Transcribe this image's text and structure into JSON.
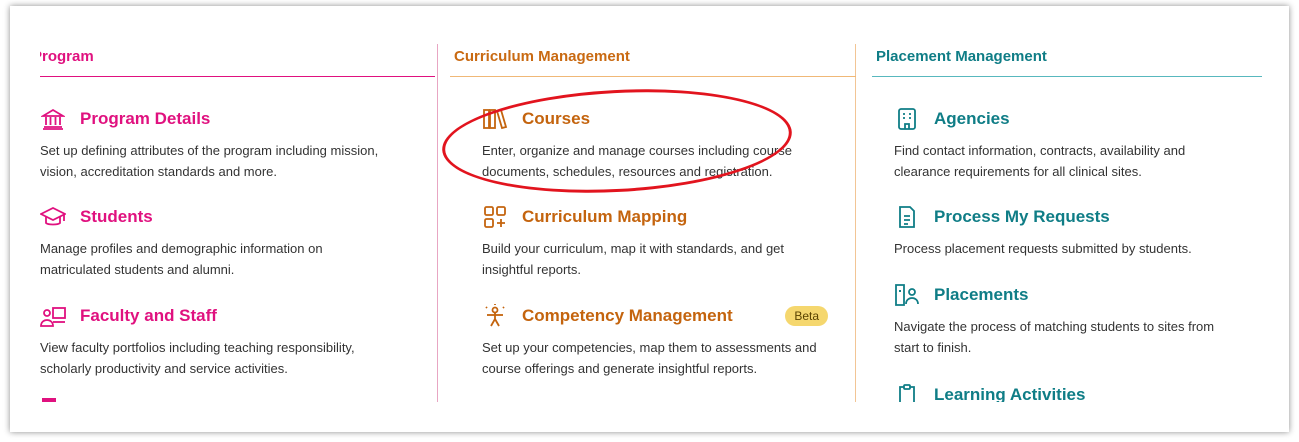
{
  "columns": {
    "program": {
      "header": "Program",
      "items": [
        {
          "title": "Program Details",
          "icon": "institution-icon",
          "desc": "Set up defining attributes of the program including mission, vision, accreditation standards and more."
        },
        {
          "title": "Students",
          "icon": "graduation-cap-icon",
          "desc": "Manage profiles and demographic information on matriculated students and alumni."
        },
        {
          "title": "Faculty and Staff",
          "icon": "presenter-icon",
          "desc": "View faculty portfolios including teaching responsibility, scholarly productivity and service activities."
        }
      ]
    },
    "curriculum": {
      "header": "Curriculum Management",
      "items": [
        {
          "title": "Courses",
          "icon": "books-icon",
          "desc": "Enter, organize and manage courses including course documents, schedules, resources and registration."
        },
        {
          "title": "Curriculum Mapping",
          "icon": "grid-plus-icon",
          "desc": "Build your curriculum, map it with standards, and get insightful reports."
        },
        {
          "title": "Competency Management",
          "icon": "competency-icon",
          "badge": "Beta",
          "desc": "Set up your competencies, map them to assessments and course offerings and generate insightful reports."
        }
      ]
    },
    "placement": {
      "header": "Placement Management",
      "items": [
        {
          "title": "Agencies",
          "icon": "building-icon",
          "desc": "Find contact information, contracts, availability and clearance requirements for all clinical sites."
        },
        {
          "title": "Process My Requests",
          "icon": "document-icon",
          "desc": "Process placement requests submitted by students."
        },
        {
          "title": "Placements",
          "icon": "placement-icon",
          "desc": "Navigate the process of matching students to sites from start to finish."
        },
        {
          "title": "Learning Activities",
          "icon": "clipboard-icon",
          "desc": ""
        }
      ]
    }
  },
  "colors": {
    "program": "#e0117f",
    "curriculum": "#c4640e",
    "placement": "#0f7d86",
    "annotation": "#e2141e"
  }
}
